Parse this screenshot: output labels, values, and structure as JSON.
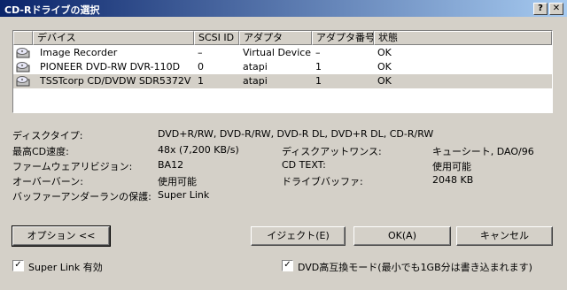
{
  "window": {
    "title": "CD-Rドライブの選択",
    "help_label": "?",
    "close_label": "✕"
  },
  "device_list": {
    "columns": [
      "デバイス",
      "SCSI ID",
      "アダプタ",
      "アダプタ番号",
      "状態"
    ],
    "rows": [
      {
        "device": "Image Recorder",
        "scsi_id": "–",
        "adapter": "Virtual Device",
        "adapter_no": "–",
        "status": "OK"
      },
      {
        "device": "PIONEER  DVD-RW  DVR-110D",
        "scsi_id": "0",
        "adapter": "atapi",
        "adapter_no": "1",
        "status": "OK"
      },
      {
        "device": "TSSTcorp CD/DVDW SDR5372V",
        "scsi_id": "1",
        "adapter": "atapi",
        "adapter_no": "1",
        "status": "OK"
      }
    ],
    "selected_row": 2
  },
  "info": {
    "disc_type_label": "ディスクタイプ:",
    "disc_type_value": "DVD+R/RW, DVD-R/RW, DVD-R DL, DVD+R DL, CD-R/RW",
    "max_speed_label": "最高CD速度:",
    "max_speed_value": "48x (7,200 KB/s)",
    "disc_at_once_label": "ディスクアットワンス:",
    "disc_at_once_value": "キューシート, DAO/96",
    "firmware_label": "ファームウェアリビジョン:",
    "firmware_value": "BA12",
    "cd_text_label": "CD TEXT:",
    "cd_text_value": "使用可能",
    "overburn_label": "オーバーバーン:",
    "overburn_value": "使用可能",
    "drive_buffer_label": "ドライブバッファ:",
    "drive_buffer_value": "2048 KB",
    "underrun_label": "バッファーアンダーランの保護:",
    "underrun_value": "Super Link"
  },
  "buttons": {
    "options": "オプション <<",
    "eject": "イジェクト(E)",
    "ok": "OK(A)",
    "cancel": "キャンセル"
  },
  "checkboxes": {
    "super_link_label": "Super Link 有効",
    "super_link_checked": true,
    "super_link_mark": "✓",
    "dvd_compat_label": "DVD高互換モード(最小でも1GB分は書き込まれます)",
    "dvd_compat_checked": true,
    "dvd_compat_mark": "✓"
  },
  "colors": {
    "title_gradient_start": "#0a246a",
    "title_gradient_end": "#a6caf0",
    "dialog_face": "#d4d0c8"
  }
}
